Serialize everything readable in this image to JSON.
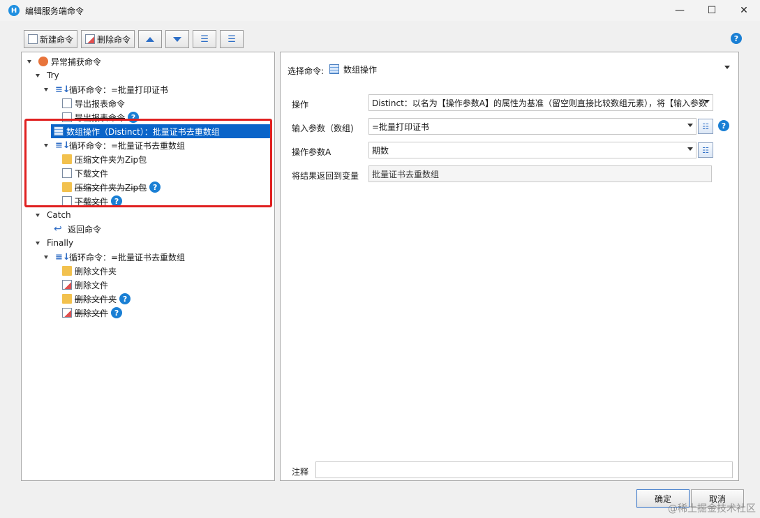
{
  "window": {
    "title": "编辑服务端命令",
    "app_icon": "H",
    "minimize": "—",
    "maximize": "☐",
    "close": "✕"
  },
  "toolbar": {
    "new_label": "新建命令",
    "delete_label": "删除命令"
  },
  "tree": {
    "exception_root": "异常捕获命令",
    "try_label": "Try",
    "loop1": "循环命令：=批量打印证书",
    "export1": "导出报表命令",
    "export2": "导出报表命令",
    "array_op": "数组操作（Distinct）：批量证书去重数组",
    "loop2": "循环命令：=批量证书去重数组",
    "zip1": "压缩文件夹为Zip包",
    "download1": "下载文件",
    "zip2": "压缩文件夹为Zip包",
    "download2": "下载文件",
    "catch_label": "Catch",
    "return_cmd": "返回命令",
    "finally_label": "Finally",
    "loop3": "循环命令：=批量证书去重数组",
    "del_folder1": "删除文件夹",
    "del_file1": "删除文件",
    "del_folder2": "删除文件夹",
    "del_file2": "删除文件"
  },
  "form": {
    "select_cmd_label": "选择命令:",
    "select_cmd_value": "数组操作",
    "operation_label": "操作",
    "operation_value": "Distinct：以名为【操作参数A】的属性为基准（留空则直接比较数组元素），将【输入参数",
    "input_label": "输入参数（数组)",
    "input_value": "=批量打印证书",
    "param_a_label": "操作参数A",
    "param_a_value": "期数",
    "return_var_label": "将结果返回到变量",
    "return_var_value": "批量证书去重数组",
    "note_label": "注释",
    "note_value": ""
  },
  "buttons": {
    "ok": "确定",
    "cancel": "取消"
  },
  "help_glyph": "?",
  "watermark": "@稀土掘金技术社区",
  "colors": {
    "selection": "#0a64c9",
    "highlight_box": "#e02020",
    "help": "#1a7fd4"
  }
}
